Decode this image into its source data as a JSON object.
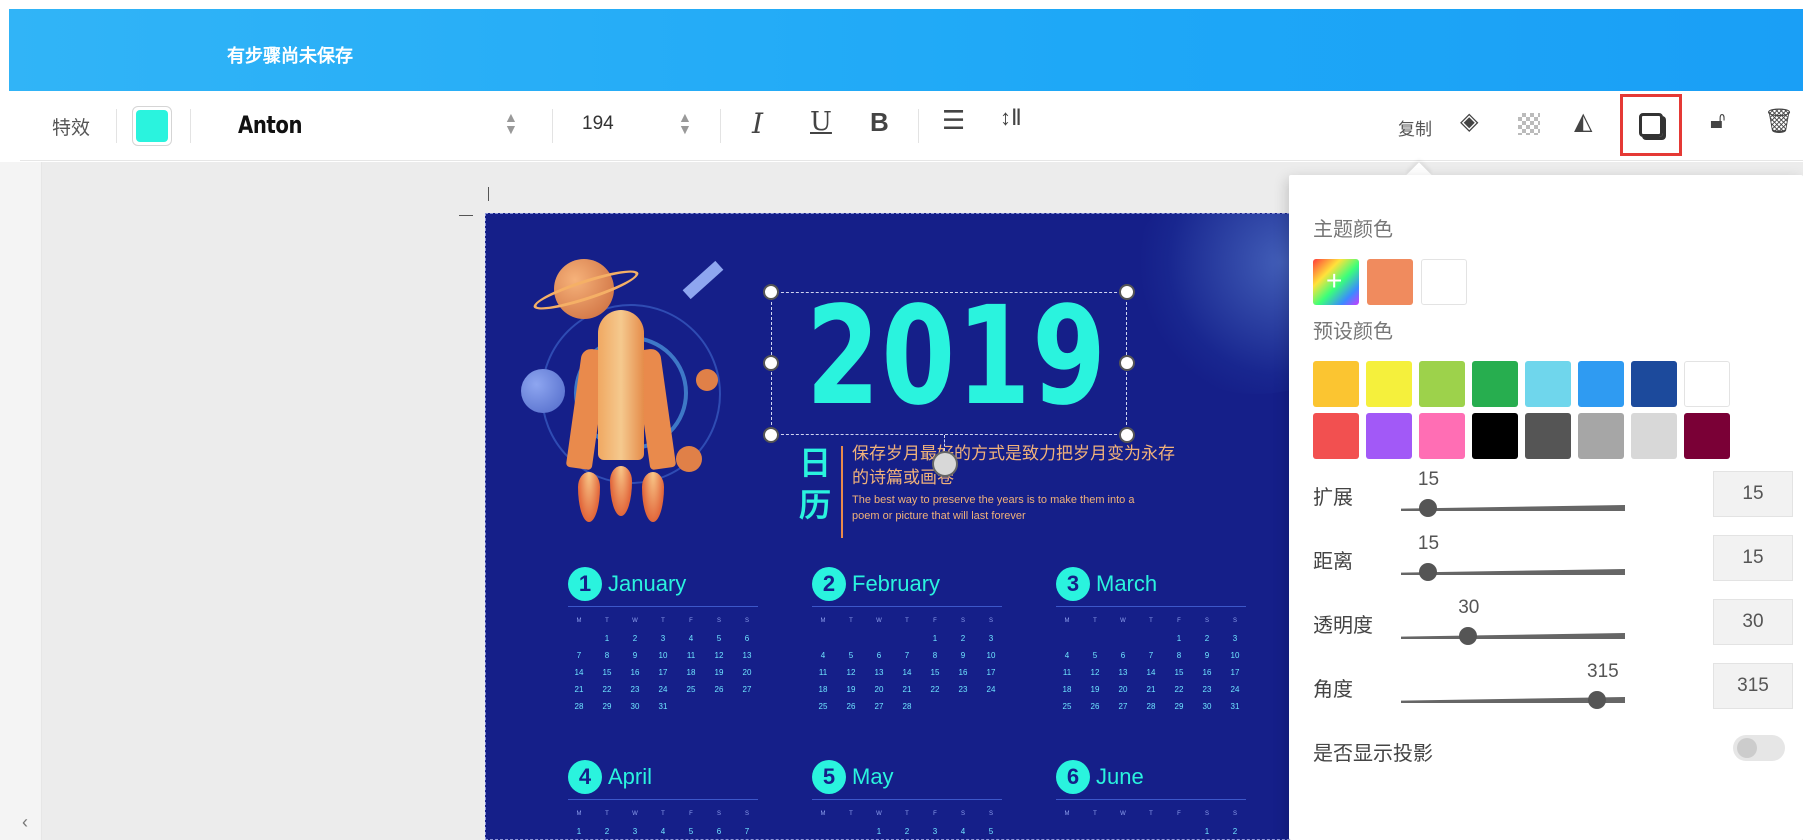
{
  "header": {
    "title": "有步骤尚未保存"
  },
  "toolbar": {
    "effects_label": "特效",
    "font_color": "#2af3de",
    "font_name": "Anton",
    "font_size": "194",
    "italic": "I",
    "underline": "U",
    "bold": "B",
    "copy_label": "复制",
    "icons": [
      "align-icon",
      "line-spacing-icon",
      "layers-icon",
      "transparency-icon",
      "flip-icon",
      "shadow-icon",
      "lock-icon",
      "delete-icon"
    ]
  },
  "poster": {
    "year": "2019",
    "ri_li": [
      "日",
      "历"
    ],
    "cn_subtitle": "保存岁月最好的方式是致力把岁月变为永存的诗篇或画卷",
    "en_subtitle": "The best way to preserve the years is to make them into a poem or picture that will last forever",
    "months": [
      {
        "num": "1",
        "name": "January"
      },
      {
        "num": "2",
        "name": "February"
      },
      {
        "num": "3",
        "name": "March"
      },
      {
        "num": "4",
        "name": "April"
      },
      {
        "num": "5",
        "name": "May"
      },
      {
        "num": "6",
        "name": "June"
      }
    ],
    "weekday_header": [
      "M",
      "T",
      "W",
      "T",
      "F",
      "S",
      "S"
    ]
  },
  "panel": {
    "theme_colors_label": "主题颜色",
    "theme_colors": [
      "#f08b5e",
      "#ffffff"
    ],
    "preset_colors_label": "预设颜色",
    "preset_colors_row1": [
      "#fbc531",
      "#f5f03c",
      "#9dd24b",
      "#27ae4f",
      "#6fd6ec",
      "#2f9bf2",
      "#1c4a9c",
      "#ffffff"
    ],
    "preset_colors_row2": [
      "#f25050",
      "#a259f7",
      "#ff6eb4",
      "#000000",
      "#555555",
      "#a6a6a6",
      "#d8d8d8",
      "#7a0036"
    ],
    "sliders": [
      {
        "label": "扩展",
        "value": "15",
        "fraction": 0.12
      },
      {
        "label": "距离",
        "value": "15",
        "fraction": 0.12
      },
      {
        "label": "透明度",
        "value": "30",
        "fraction": 0.3
      },
      {
        "label": "角度",
        "value": "315",
        "fraction": 0.875
      }
    ],
    "show_shadow_label": "是否显示投影",
    "show_shadow_on": false
  }
}
